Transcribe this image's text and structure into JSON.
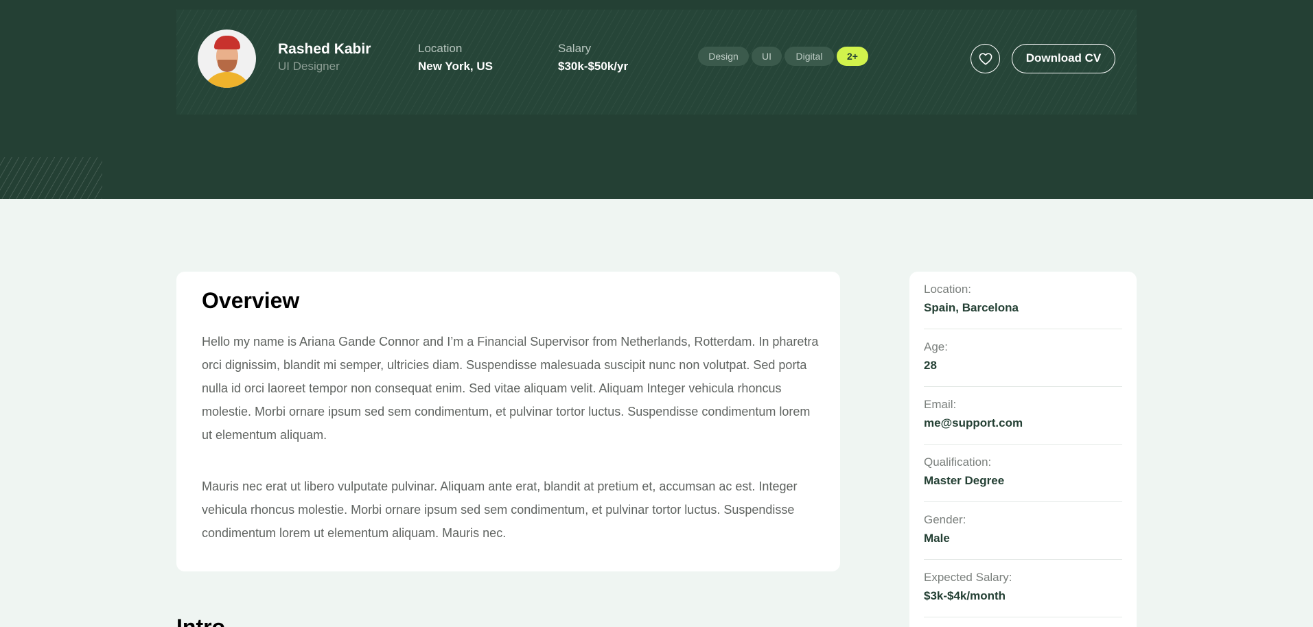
{
  "profile": {
    "name": "Rashed Kabir",
    "role": "UI Designer",
    "location_label": "Location",
    "location_value": "New York, US",
    "salary_label": "Salary",
    "salary_value": "$30k-$50k/yr",
    "tags": [
      "Design",
      "UI",
      "Digital"
    ],
    "tags_more": "2+",
    "download_cv_label": "Download CV",
    "favorite_icon": "heart-icon"
  },
  "overview": {
    "title": "Overview",
    "paragraphs": [
      "Hello my name is Ariana Gande Connor and I’m a Financial Supervisor from Netherlands, Rotterdam. In pharetra orci dignissim, blandit mi semper, ultricies diam. Suspendisse malesuada suscipit nunc non volutpat. Sed porta nulla id orci laoreet tempor non consequat enim. Sed vitae aliquam velit. Aliquam Integer vehicula rhoncus molestie. Morbi ornare ipsum sed sem condimentum, et pulvinar tortor luctus. Suspendisse condimentum lorem ut elementum aliquam.",
      "Mauris nec erat ut libero vulputate pulvinar. Aliquam ante erat, blandit at pretium et, accumsan ac est. Integer vehicula rhoncus molestie. Morbi ornare ipsum sed sem condimentum, et pulvinar tortor luctus. Suspendisse condimentum lorem ut elementum aliquam. Mauris nec."
    ],
    "next_section_title": "Intro"
  },
  "details": [
    {
      "label": "Location:",
      "value": "Spain, Barcelona"
    },
    {
      "label": "Age:",
      "value": "28"
    },
    {
      "label": "Email:",
      "value": "me@support.com"
    },
    {
      "label": "Qualification:",
      "value": "Master Degree"
    },
    {
      "label": "Gender:",
      "value": "Male"
    },
    {
      "label": "Expected Salary:",
      "value": "$3k-$4k/month"
    }
  ],
  "colors": {
    "hero_bg": "#244034",
    "accent": "#d2f34c",
    "page_bg": "#eff5f2"
  }
}
